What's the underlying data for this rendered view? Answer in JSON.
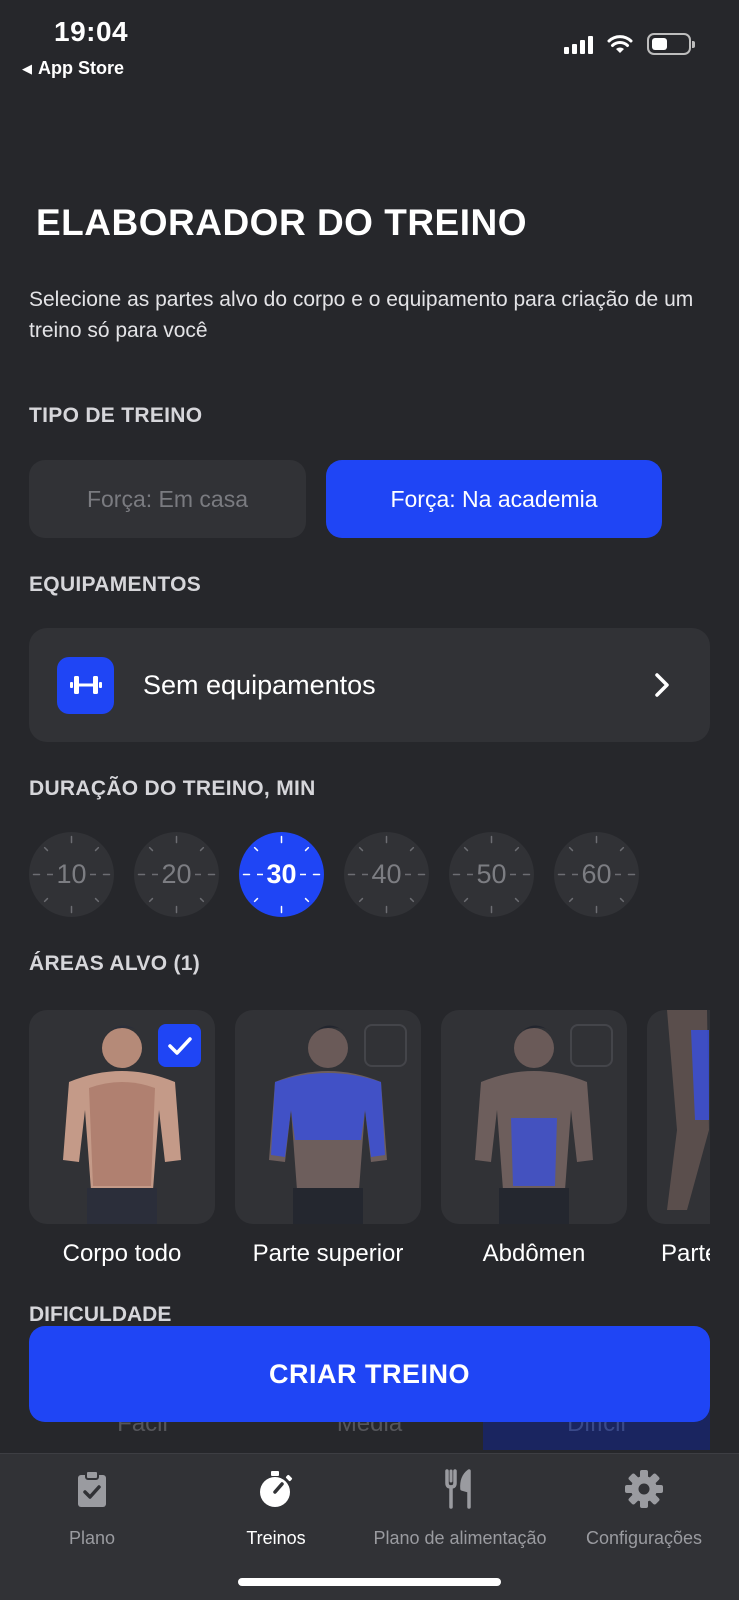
{
  "status": {
    "time": "19:04",
    "back_label": "App Store"
  },
  "header": {
    "title": "ELABORADOR DO TREINO",
    "subtitle": "Selecione as partes alvo do corpo e o equipamento para criação de um treino só para você"
  },
  "workout_type": {
    "label": "TIPO DE TREINO",
    "options": [
      "Força: Em casa",
      "Força: Na academia"
    ],
    "selected": "Força: Na academia"
  },
  "equipment": {
    "label": "EQUIPAMENTOS",
    "value": "Sem equipamentos",
    "icon": "dumbbell-icon"
  },
  "duration": {
    "label": "DURAÇÃO DO TREINO, MIN",
    "options": [
      "10",
      "20",
      "30",
      "40",
      "50",
      "60"
    ],
    "selected": "30"
  },
  "areas": {
    "label": "ÁREAS ALVO (1)",
    "items": [
      {
        "label": "Corpo todo",
        "checked": true
      },
      {
        "label": "Parte superior",
        "checked": false
      },
      {
        "label": "Abdômen",
        "checked": false
      },
      {
        "label": "Parte",
        "checked": false
      }
    ]
  },
  "difficulty": {
    "label": "DIFICULDADE",
    "options": [
      "Fácil",
      "Média",
      "Difícil"
    ],
    "selected": "Difícil"
  },
  "create_button": "CRIAR TREINO",
  "tabbar": {
    "items": [
      {
        "label": "Plano",
        "icon": "clipboard-icon"
      },
      {
        "label": "Treinos",
        "icon": "stopwatch-icon"
      },
      {
        "label": "Plano de alimentação",
        "icon": "fork-knife-icon"
      },
      {
        "label": "Configurações",
        "icon": "gear-icon"
      }
    ],
    "active": "Treinos"
  },
  "colors": {
    "background": "#26272b",
    "card": "#313236",
    "accent": "#1f45f5"
  }
}
